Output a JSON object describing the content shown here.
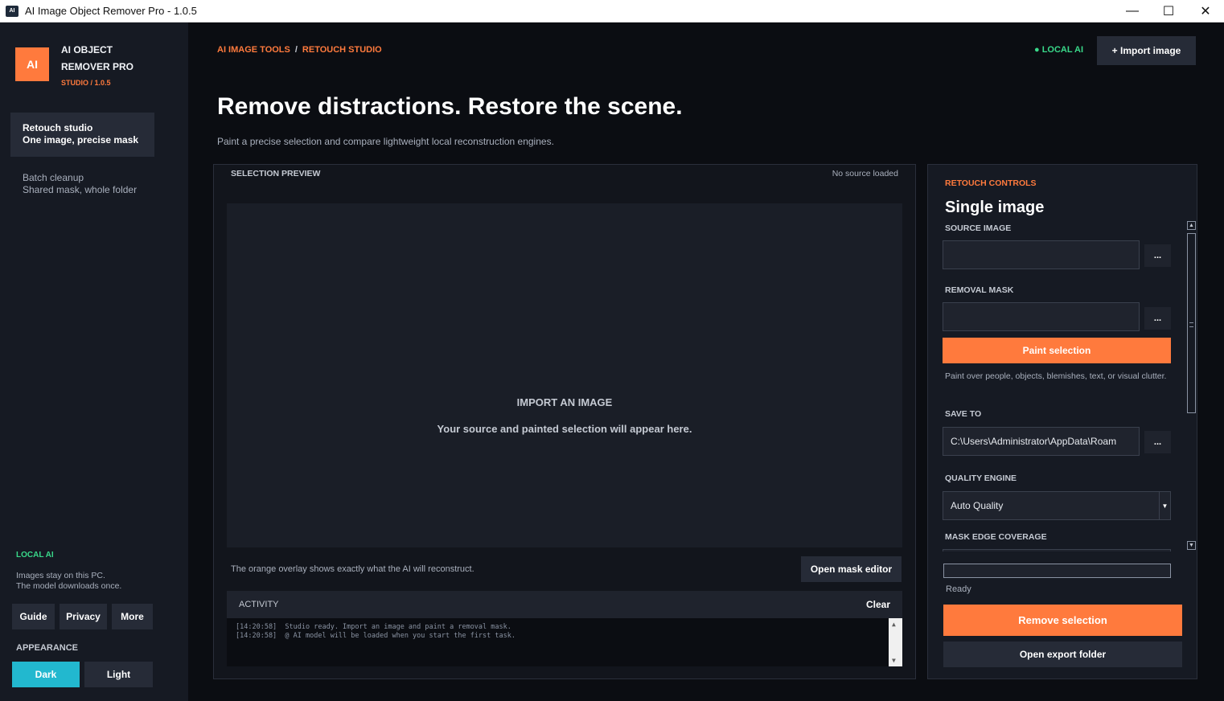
{
  "window": {
    "icon_text": "AI",
    "title": "AI Image Object Remover Pro - 1.0.5",
    "min_glyph": "—",
    "max_glyph": "☐",
    "close_glyph": "✕"
  },
  "sidebar": {
    "logo": "AI",
    "brand_line1": "AI OBJECT",
    "brand_line2": "REMOVER PRO",
    "brand_version": "STUDIO / 1.0.5",
    "nav": [
      {
        "title": "Retouch studio",
        "subtitle": "One image, precise mask"
      },
      {
        "title": "Batch cleanup",
        "subtitle": "Shared mask, whole folder"
      }
    ],
    "local_title": "LOCAL AI",
    "local_line1": "Images stay on this PC.",
    "local_line2": "The model downloads once.",
    "buttons": {
      "guide": "Guide",
      "privacy": "Privacy",
      "more": "More"
    },
    "appearance_label": "APPEARANCE",
    "theme_dark": "Dark",
    "theme_light": "Light"
  },
  "header": {
    "crumb1": "AI IMAGE TOOLS",
    "crumb_sep": "/",
    "crumb2": "RETOUCH STUDIO",
    "local_badge": "● LOCAL AI",
    "import_button": "+  Import image",
    "hero": "Remove distractions. Restore the scene.",
    "subhero": "Paint a precise selection and compare lightweight local reconstruction engines."
  },
  "preview": {
    "label": "SELECTION PREVIEW",
    "status": "No source loaded",
    "empty_title": "IMPORT AN IMAGE",
    "empty_subtitle": "Your source and painted selection will appear here.",
    "hint": "The orange overlay shows exactly what the AI will reconstruct.",
    "mask_button": "Open mask editor"
  },
  "activity": {
    "title": "ACTIVITY",
    "clear": "Clear",
    "lines": [
      "[14:20:58]  Studio ready. Import an image and paint a removal mask.",
      "[14:20:58]  @ AI model will be loaded when you start the first task."
    ]
  },
  "controls": {
    "kicker": "RETOUCH CONTROLS",
    "title": "Single image",
    "source_label": "SOURCE IMAGE",
    "source_value": "",
    "mask_label": "REMOVAL MASK",
    "mask_value": "",
    "browse": "...",
    "paint_button": "Paint selection",
    "paint_hint": "Paint over people, objects, blemishes, text, or visual clutter.",
    "save_label": "SAVE TO",
    "save_value": "C:\\Users\\Administrator\\AppData\\Roam",
    "quality_label": "QUALITY ENGINE",
    "quality_value": "Auto Quality",
    "edge_label": "MASK EDGE COVERAGE",
    "progress": 0,
    "status": "Ready",
    "remove_button": "Remove selection",
    "export_button": "Open export folder"
  },
  "colors": {
    "accent": "#ff7a3d",
    "local_green": "#39d98a",
    "dark_theme_active": "#22b8cf"
  }
}
